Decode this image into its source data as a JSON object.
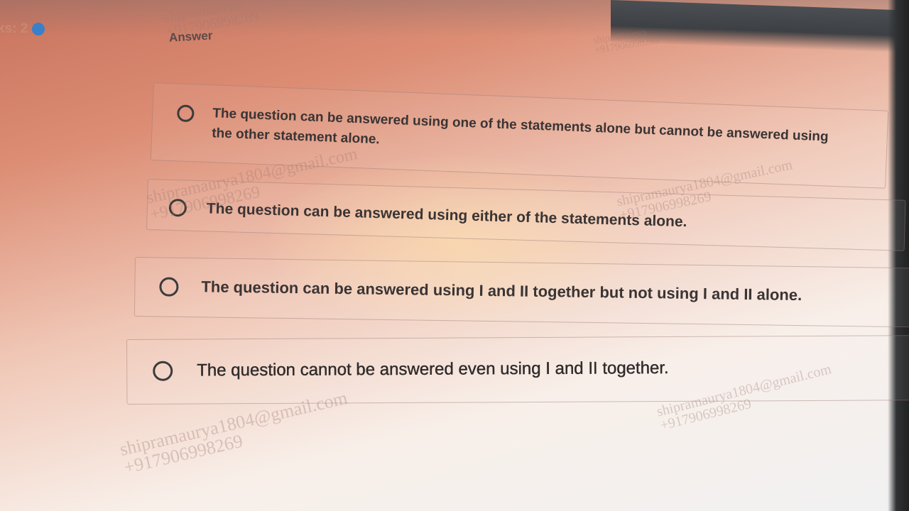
{
  "header": {
    "marks_label": "ks: 2",
    "answer_label": "Answer"
  },
  "options": [
    {
      "label": "The question can be answered using one of the statements alone but cannot be answered using the other statement alone."
    },
    {
      "label": "The question can be answered using either of the statements alone."
    },
    {
      "label": "The question can be answered using I and II together but not using I and II alone."
    },
    {
      "label": "The question cannot be answered even using I and II together."
    }
  ],
  "watermarks": [
    {
      "name": "shipramaurya",
      "phone": "+917906998269"
    },
    {
      "name": "shipramaurya",
      "phone": "+917906998269"
    },
    {
      "name": "shipramaurya1804@gmail.com",
      "phone": "+917906998269"
    },
    {
      "name": "shipramaurya1804@gmail.com",
      "phone": "+917906998269"
    },
    {
      "name": "shipramaurya1804@gmail.com",
      "phone": "+917906998269"
    },
    {
      "name": "shipramaurya1804@gmail.com",
      "phone": "+917906998269"
    }
  ],
  "colors": {
    "accent_dot": "#3a7fc9",
    "text": "#3a3434",
    "radio_border": "#3b3b3b"
  }
}
